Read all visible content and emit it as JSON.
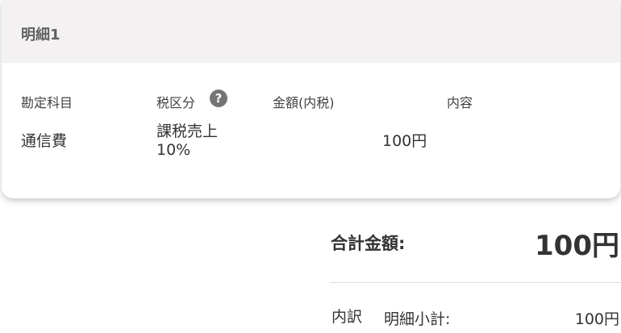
{
  "detail_card": {
    "title": "明細1",
    "columns": {
      "account": "勘定科目",
      "tax_category": "税区分",
      "amount": "金額(内税)",
      "content": "内容"
    },
    "row": {
      "account": "通信費",
      "tax_category_line1": "課税売上",
      "tax_category_line2": "10%",
      "amount": "100円",
      "content": ""
    },
    "help_icon": "question-circle-icon",
    "help_glyph": "?"
  },
  "totals": {
    "total_label": "合計金額:",
    "total_value": "100円",
    "breakdown_label": "内訳",
    "subtotal_label": "明細小計:",
    "subtotal_value": "100円"
  },
  "colors": {
    "header_bg": "#f4f1f2",
    "text": "#333333",
    "muted_text": "#616161",
    "icon": "#757575"
  }
}
